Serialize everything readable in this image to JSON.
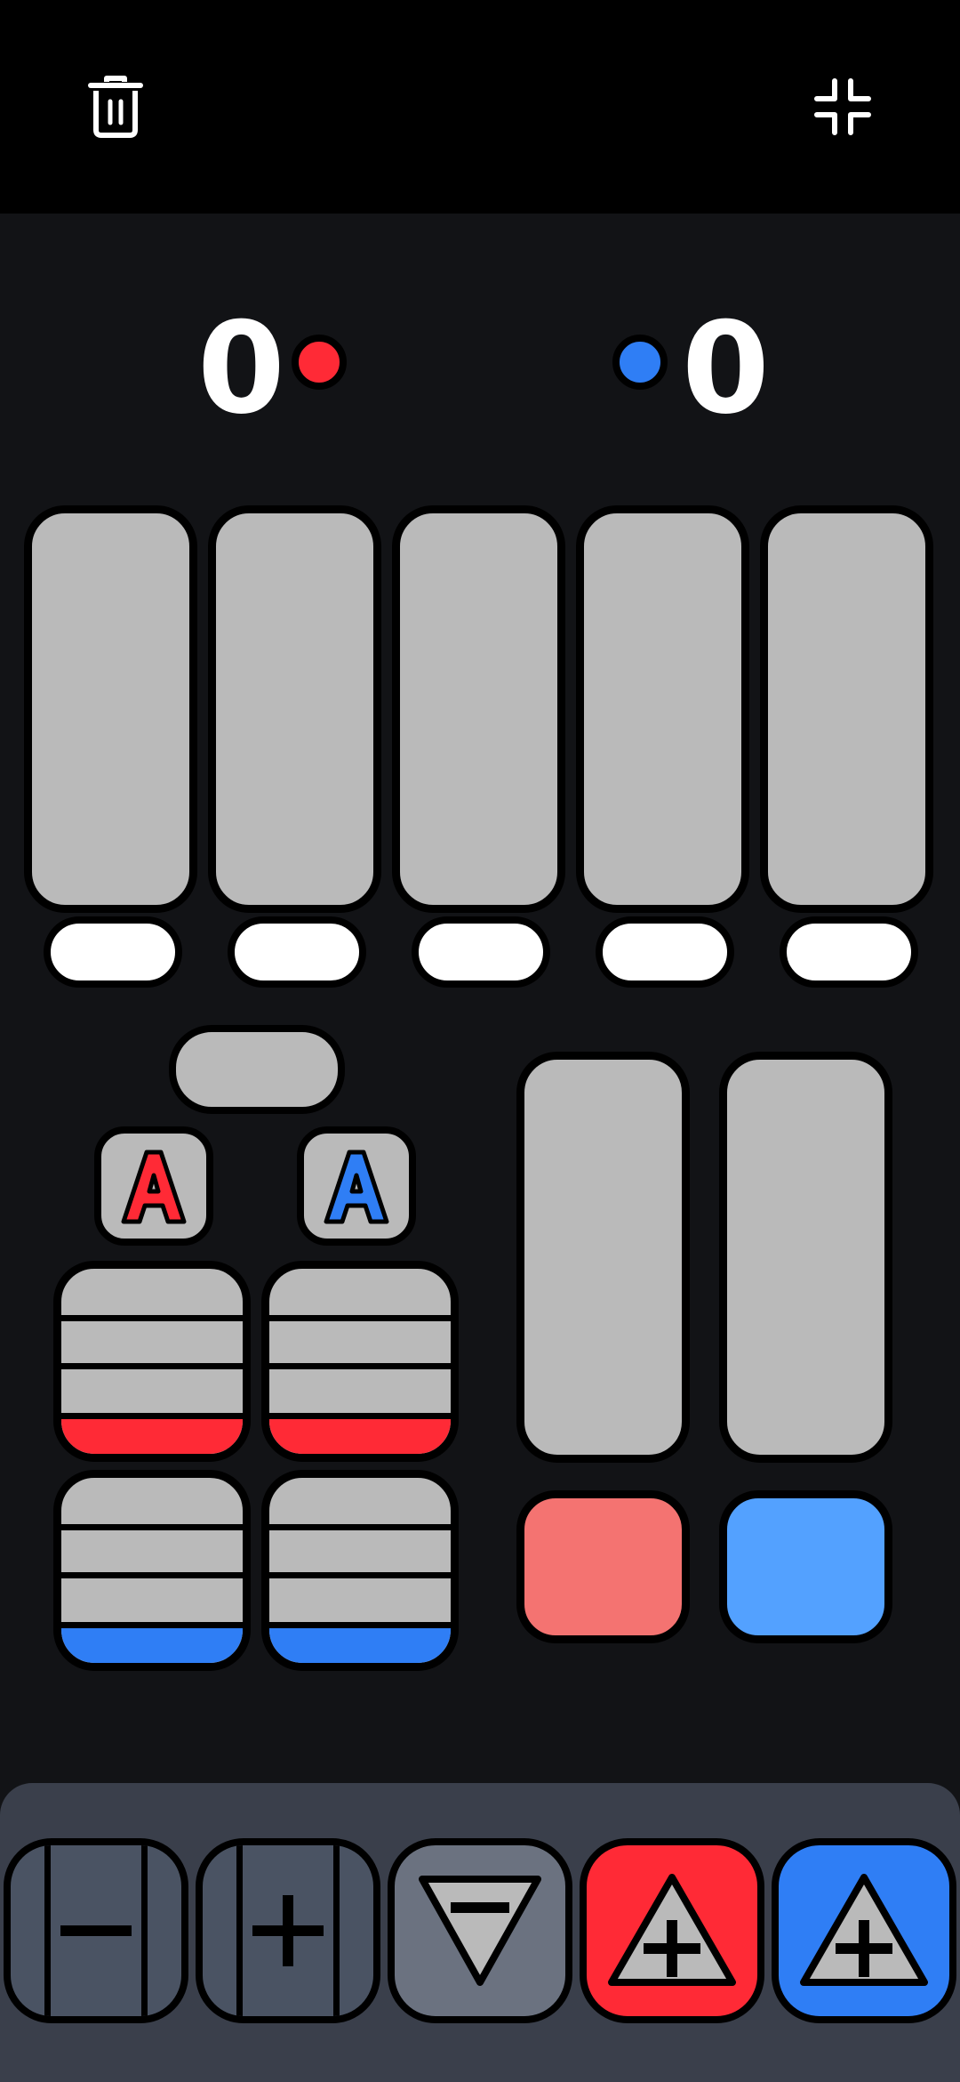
{
  "toolbar": {
    "delete_icon": "trash-icon",
    "exit_fullscreen_icon": "exit-fullscreen-icon"
  },
  "scores": {
    "red": {
      "value": "0",
      "color": "#ff2a36"
    },
    "blue": {
      "value": "0",
      "color": "#2f7ef5"
    }
  },
  "tokens": {
    "red_letter": "A",
    "blue_letter": "A"
  },
  "colors": {
    "red": "#ff2a36",
    "blue": "#2f7ef5",
    "light_red": "#f47371",
    "light_blue": "#53a1ff",
    "tile": "#bababa",
    "panel": "#3a3f4b",
    "tool_dark": "#4a5363",
    "tool_mid": "#6b7280"
  },
  "bottom_tools": [
    {
      "name": "decrease-rail-button",
      "icon": "minus-icon"
    },
    {
      "name": "increase-rail-button",
      "icon": "plus-icon"
    },
    {
      "name": "decrease-triangle-button",
      "icon": "triangle-minus-icon"
    },
    {
      "name": "red-increase-triangle-button",
      "icon": "triangle-plus-icon"
    },
    {
      "name": "blue-increase-triangle-button",
      "icon": "triangle-plus-icon"
    }
  ]
}
